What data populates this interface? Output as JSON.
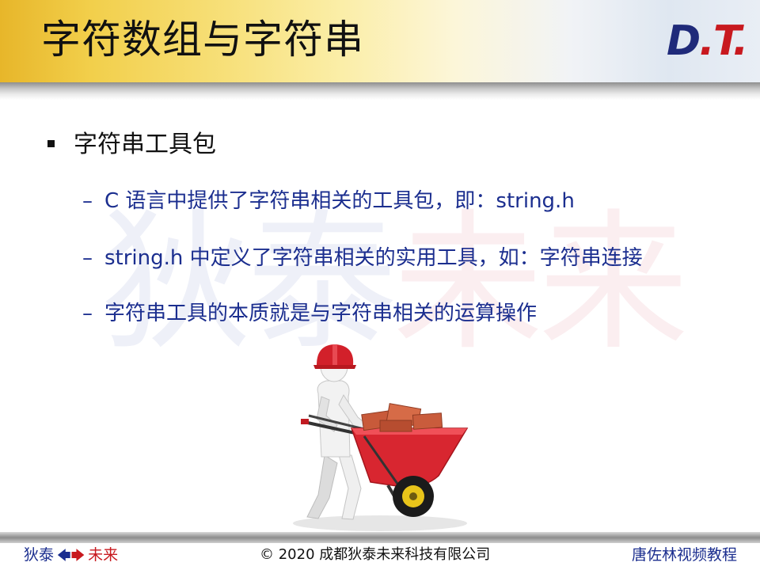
{
  "header": {
    "title": "字符数组与字符串",
    "logo": {
      "d": "D",
      "dot1": ".",
      "t": "T",
      "dot2": "."
    }
  },
  "watermark": {
    "part1": "狄泰",
    "part2": "未来"
  },
  "content": {
    "main_bullet": "字符串工具包",
    "sub_items": [
      {
        "dash": "–",
        "text": "C 语言中提供了字符串相关的工具包，即：string.h"
      },
      {
        "dash": "–",
        "text": "string.h 中定义了字符串相关的实用工具，如：字符串连接"
      },
      {
        "dash": "–",
        "text": "字符串工具的本质就是与字符串相关的运算操作"
      }
    ]
  },
  "footer": {
    "left_a": "狄泰",
    "left_arrow_l": "🡄",
    "left_arrow_r": "🡆",
    "left_b": "未来",
    "center": "© 2020 成都狄泰未来科技有限公司",
    "right": "唐佐林视频教程"
  },
  "colors": {
    "title_text": "#111111",
    "bullet_blue": "#1b2e8f",
    "brand_red": "#c8191f",
    "header_gold": "#e7b62a"
  },
  "illustration": {
    "icon": "worker-wheelbarrow-bricks-icon"
  }
}
